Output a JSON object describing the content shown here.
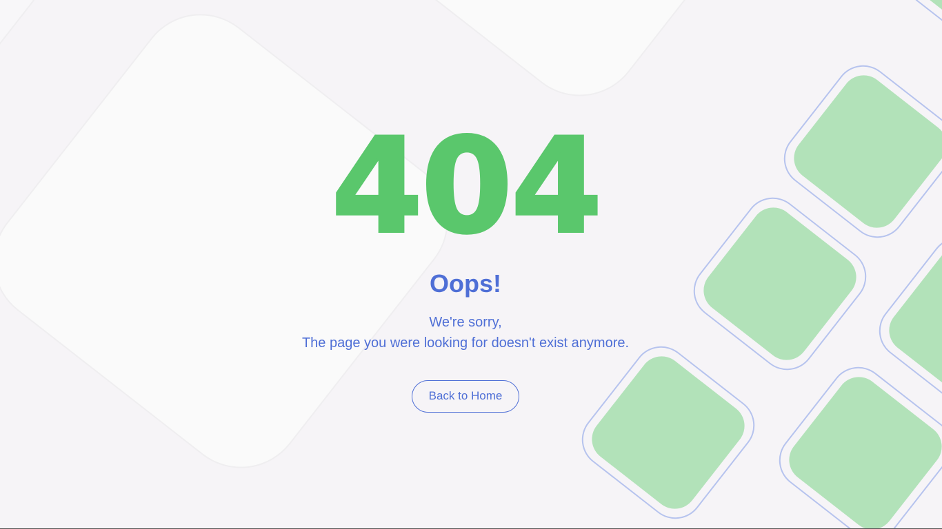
{
  "error": {
    "code": "404",
    "title": "Oops!",
    "message_line1": "We're sorry,",
    "message_line2": "The page you were looking for doesn't exist anymore."
  },
  "actions": {
    "home_label": "Back to Home"
  },
  "colors": {
    "code": "#5ac76c",
    "text": "#4f6fd6",
    "tile_fill": "#b2e2b9",
    "tile_outline": "#b6c3ee",
    "background": "#f6f4f7",
    "light_shape": "#fafafa"
  }
}
